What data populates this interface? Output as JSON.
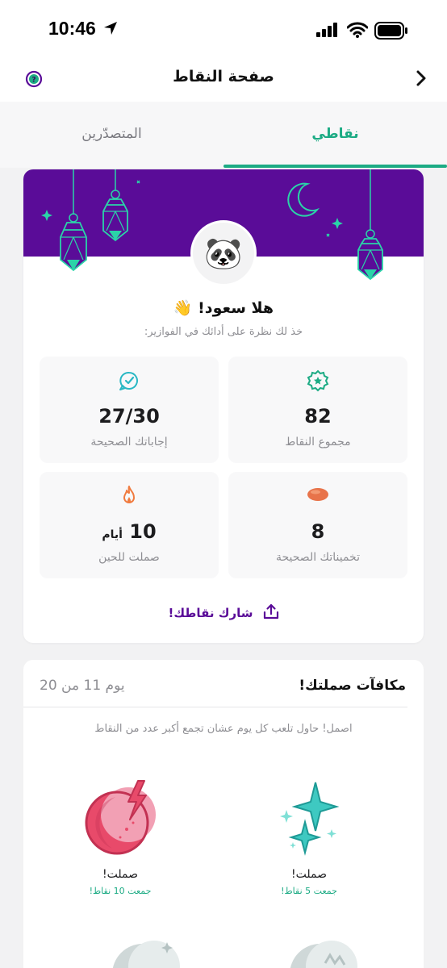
{
  "status_bar": {
    "time": "10:46"
  },
  "header": {
    "title": "صفحة النقاط"
  },
  "tabs": [
    {
      "label": "نقاطي",
      "active": true
    },
    {
      "label": "المتصدّرين",
      "active": false
    }
  ],
  "profile": {
    "avatar_emoji": "🐼",
    "greeting": "هلا سعود! 👋",
    "subtitle": "خذ لك نظرة على أدائك في الفوازير:"
  },
  "stats": {
    "total_points": {
      "value": "82",
      "label": "مجموع النقاط",
      "icon": "star-badge-icon"
    },
    "correct_answers": {
      "value": "27/30",
      "label": "إجاباتك الصحيحة",
      "icon": "chat-check-icon"
    },
    "correct_guesses": {
      "value": "8",
      "label": "تخميناتك الصحيحة",
      "icon": "date-fruit-icon"
    },
    "streak": {
      "value": "10",
      "unit": "أيام",
      "label": "صملت للحين",
      "icon": "flame-icon"
    }
  },
  "share": {
    "label": "شارك نقاطك!",
    "icon": "share-icon"
  },
  "rewards": {
    "title": "مكافآت صملتك!",
    "day_label": "يوم 11 من 20",
    "description": "اصمل! حاول تلعب كل يوم عشان تجمع أكبر عدد من النقاط",
    "items": [
      {
        "title": "صملت!",
        "points_text": "جمعت 5 نقاط!",
        "icon": "sparkles-icon"
      },
      {
        "title": "صملت!",
        "points_text": "جمعت 10 نقاط!",
        "icon": "crescent-bolt-icon"
      }
    ]
  },
  "colors": {
    "brand_purple": "#5a0c98",
    "accent_green": "#1cab84"
  }
}
